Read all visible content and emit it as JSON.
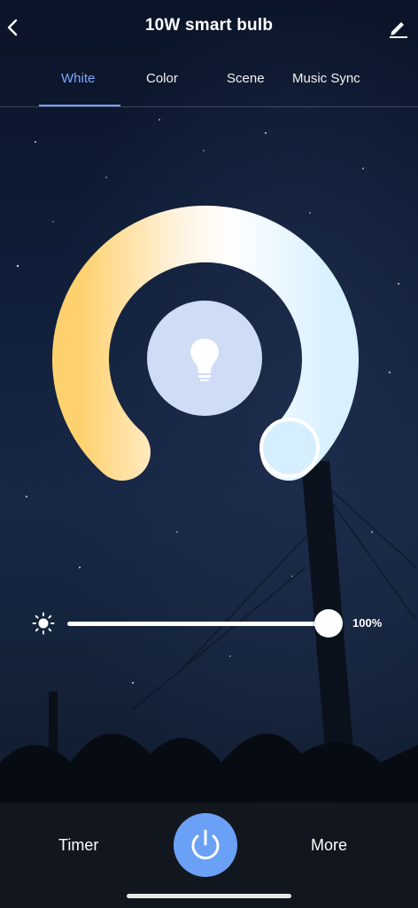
{
  "header": {
    "title": "10W smart bulb",
    "back_icon": "chevron-left-icon",
    "edit_icon": "pencil-icon"
  },
  "tabs": [
    {
      "label": "White",
      "active": true
    },
    {
      "label": "Color",
      "active": false
    },
    {
      "label": "Scene",
      "active": false
    },
    {
      "label": "Music Sync",
      "active": false
    }
  ],
  "colors": {
    "accent": "#7fa6ff",
    "power": "#6aa0f5",
    "warm": "#ffd16e",
    "cool": "#d8f0ff"
  },
  "brightness": {
    "icon": "sun-icon",
    "value": 1.0,
    "label": "100%"
  },
  "footer": {
    "timer_label": "Timer",
    "more_label": "More",
    "power_icon": "power-icon"
  }
}
